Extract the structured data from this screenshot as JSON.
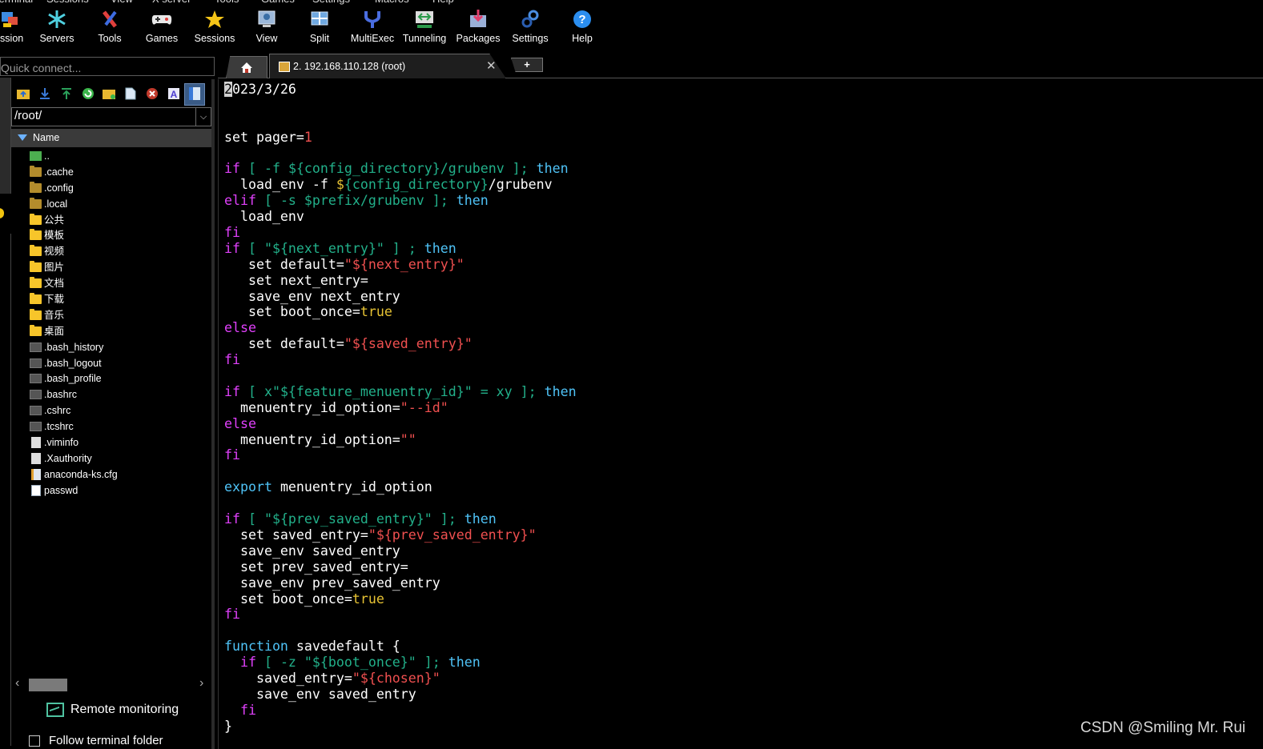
{
  "menubar": [
    "Terminal",
    "Sessions",
    "View",
    "X server",
    "Tools",
    "Games",
    "Settings",
    "Macros",
    "Help"
  ],
  "toolbar": {
    "items": [
      {
        "label": "Session",
        "icon": "session-icon"
      },
      {
        "label": "Servers",
        "icon": "servers-icon"
      },
      {
        "label": "Tools",
        "icon": "tools-icon"
      },
      {
        "label": "Games",
        "icon": "games-icon"
      },
      {
        "label": "Sessions",
        "icon": "star-icon"
      },
      {
        "label": "View",
        "icon": "view-icon"
      },
      {
        "label": "Split",
        "icon": "split-icon"
      },
      {
        "label": "MultiExec",
        "icon": "multiexec-icon"
      },
      {
        "label": "Tunneling",
        "icon": "tunneling-icon"
      },
      {
        "label": "Packages",
        "icon": "packages-icon"
      },
      {
        "label": "Settings",
        "icon": "gear-icon"
      },
      {
        "label": "Help",
        "icon": "help-icon"
      }
    ]
  },
  "quick_connect": {
    "placeholder": "Quick connect..."
  },
  "sftp": {
    "path": "/root/",
    "column_header": "Name",
    "files": [
      {
        "name": "..",
        "kind": "updir"
      },
      {
        "name": ".cache",
        "kind": "folder-dim"
      },
      {
        "name": ".config",
        "kind": "folder-dim"
      },
      {
        "name": ".local",
        "kind": "folder-dim"
      },
      {
        "name": "公共",
        "kind": "folder"
      },
      {
        "name": "模板",
        "kind": "folder"
      },
      {
        "name": "视频",
        "kind": "folder"
      },
      {
        "name": "图片",
        "kind": "folder"
      },
      {
        "name": "文档",
        "kind": "folder"
      },
      {
        "name": "下载",
        "kind": "folder"
      },
      {
        "name": "音乐",
        "kind": "folder"
      },
      {
        "name": "桌面",
        "kind": "folder"
      },
      {
        "name": ".bash_history",
        "kind": "file-dark"
      },
      {
        "name": ".bash_logout",
        "kind": "file-dark"
      },
      {
        "name": ".bash_profile",
        "kind": "file-dark"
      },
      {
        "name": ".bashrc",
        "kind": "file-dark"
      },
      {
        "name": ".cshrc",
        "kind": "file-dark"
      },
      {
        "name": ".tcshrc",
        "kind": "file-dark"
      },
      {
        "name": ".viminfo",
        "kind": "file-light"
      },
      {
        "name": ".Xauthority",
        "kind": "file-light"
      },
      {
        "name": "anaconda-ks.cfg",
        "kind": "file-cfg"
      },
      {
        "name": "passwd",
        "kind": "file-white"
      }
    ],
    "remote_monitoring": "Remote monitoring",
    "follow_terminal": "Follow terminal folder"
  },
  "tabs": {
    "session_title": "2. 192.168.110.128 (root)",
    "close_glyph": "✕",
    "add_glyph": "+"
  },
  "terminal": {
    "lines": [
      [
        {
          "t": "2",
          "c": "cursor"
        },
        {
          "t": "023/3/26",
          "c": "w"
        }
      ],
      [],
      [],
      [
        {
          "t": "set pager=",
          "c": "w"
        },
        {
          "t": "1",
          "c": "r"
        }
      ],
      [],
      [
        {
          "t": "if",
          "c": "k"
        },
        {
          "t": " [ -f ",
          "c": "g"
        },
        {
          "t": "${config_directory}",
          "c": "g"
        },
        {
          "t": "/grubenv ]; ",
          "c": "g"
        },
        {
          "t": "then",
          "c": "c"
        }
      ],
      [
        {
          "t": "  load_env -f ",
          "c": "w"
        },
        {
          "t": "$",
          "c": "y"
        },
        {
          "t": "{config_directory}",
          "c": "g"
        },
        {
          "t": "/grubenv",
          "c": "w"
        }
      ],
      [
        {
          "t": "elif",
          "c": "k"
        },
        {
          "t": " [ -s $prefix/grubenv ]; ",
          "c": "g"
        },
        {
          "t": "then",
          "c": "c"
        }
      ],
      [
        {
          "t": "  load_env",
          "c": "w"
        }
      ],
      [
        {
          "t": "fi",
          "c": "k"
        }
      ],
      [
        {
          "t": "if",
          "c": "k"
        },
        {
          "t": " [ \"",
          "c": "g"
        },
        {
          "t": "${next_entry}",
          "c": "g"
        },
        {
          "t": "\" ] ; ",
          "c": "g"
        },
        {
          "t": "then",
          "c": "c"
        }
      ],
      [
        {
          "t": "   set default=",
          "c": "w"
        },
        {
          "t": "\"${next_entry}\"",
          "c": "r"
        }
      ],
      [
        {
          "t": "   set next_entry=",
          "c": "w"
        }
      ],
      [
        {
          "t": "   save_env next_entry",
          "c": "w"
        }
      ],
      [
        {
          "t": "   set boot_once=",
          "c": "w"
        },
        {
          "t": "true",
          "c": "y"
        }
      ],
      [
        {
          "t": "else",
          "c": "k"
        }
      ],
      [
        {
          "t": "   set default=",
          "c": "w"
        },
        {
          "t": "\"${saved_entry}\"",
          "c": "r"
        }
      ],
      [
        {
          "t": "fi",
          "c": "k"
        }
      ],
      [],
      [
        {
          "t": "if",
          "c": "k"
        },
        {
          "t": " [ x\"",
          "c": "g"
        },
        {
          "t": "${feature_menuentry_id}",
          "c": "g"
        },
        {
          "t": "\" = xy ]; ",
          "c": "g"
        },
        {
          "t": "then",
          "c": "c"
        }
      ],
      [
        {
          "t": "  menuentry_id_option=",
          "c": "w"
        },
        {
          "t": "\"--id\"",
          "c": "r"
        }
      ],
      [
        {
          "t": "else",
          "c": "k"
        }
      ],
      [
        {
          "t": "  menuentry_id_option=",
          "c": "w"
        },
        {
          "t": "\"\"",
          "c": "r"
        }
      ],
      [
        {
          "t": "fi",
          "c": "k"
        }
      ],
      [],
      [
        {
          "t": "export",
          "c": "c"
        },
        {
          "t": " menuentry_id_option",
          "c": "w"
        }
      ],
      [],
      [
        {
          "t": "if",
          "c": "k"
        },
        {
          "t": " [ \"",
          "c": "g"
        },
        {
          "t": "${prev_saved_entry}",
          "c": "g"
        },
        {
          "t": "\" ]; ",
          "c": "g"
        },
        {
          "t": "then",
          "c": "c"
        }
      ],
      [
        {
          "t": "  set saved_entry=",
          "c": "w"
        },
        {
          "t": "\"${prev_saved_entry}\"",
          "c": "r"
        }
      ],
      [
        {
          "t": "  save_env saved_entry",
          "c": "w"
        }
      ],
      [
        {
          "t": "  set prev_saved_entry=",
          "c": "w"
        }
      ],
      [
        {
          "t": "  save_env prev_saved_entry",
          "c": "w"
        }
      ],
      [
        {
          "t": "  set boot_once=",
          "c": "w"
        },
        {
          "t": "true",
          "c": "y"
        }
      ],
      [
        {
          "t": "fi",
          "c": "k"
        }
      ],
      [],
      [
        {
          "t": "function",
          "c": "c"
        },
        {
          "t": " savedefault {",
          "c": "w"
        }
      ],
      [
        {
          "t": "  if",
          "c": "k"
        },
        {
          "t": " [ -z \"",
          "c": "g"
        },
        {
          "t": "${boot_once}",
          "c": "g"
        },
        {
          "t": "\" ]; ",
          "c": "g"
        },
        {
          "t": "then",
          "c": "c"
        }
      ],
      [
        {
          "t": "    saved_entry=",
          "c": "w"
        },
        {
          "t": "\"${chosen}\"",
          "c": "r"
        }
      ],
      [
        {
          "t": "    save_env saved_entry",
          "c": "w"
        }
      ],
      [
        {
          "t": "  fi",
          "c": "k"
        }
      ],
      [
        {
          "t": "}",
          "c": "w"
        }
      ]
    ]
  },
  "watermark": "CSDN @Smiling Mr. Rui",
  "colors": {
    "keyword": "#e040fb",
    "builtin": "#4fc3f7",
    "variable": "#22b08a",
    "string": "#f05050",
    "literal": "#e6c233"
  }
}
